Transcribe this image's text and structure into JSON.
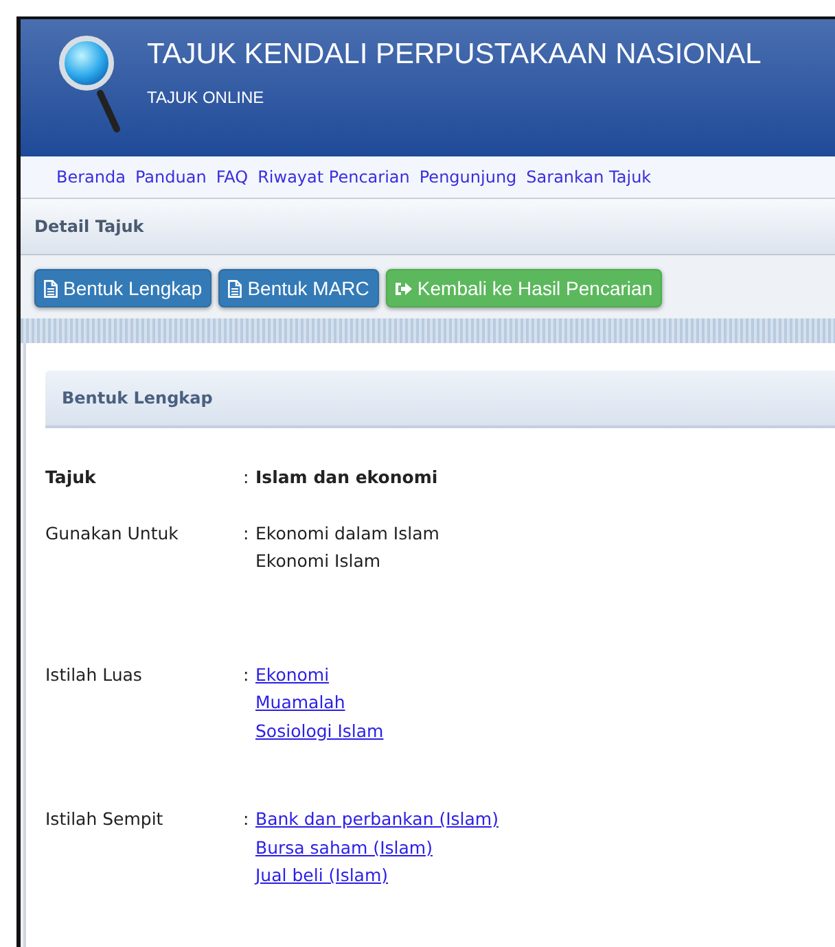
{
  "header": {
    "title": "TAJUK KENDALI PERPUSTAKAAN NASIONAL",
    "subtitle": "TAJUK ONLINE"
  },
  "nav": [
    "Beranda",
    "Panduan",
    "FAQ",
    "Riwayat Pencarian",
    "Pengunjung",
    "Sarankan Tajuk"
  ],
  "page_title": "Detail Tajuk",
  "buttons": [
    {
      "label": "Bentuk Lengkap",
      "kind": "primary"
    },
    {
      "label": "Bentuk MARC",
      "kind": "primary"
    },
    {
      "label": "Kembali ke Hasil Pencarian",
      "kind": "success"
    }
  ],
  "section": {
    "title": "Bentuk Lengkap",
    "fields": [
      {
        "label": "Tajuk",
        "separator": ":",
        "kind": "bold",
        "values": [
          "Islam dan ekonomi"
        ]
      },
      {
        "label": "Gunakan Untuk",
        "separator": ":",
        "kind": "text",
        "values": [
          "Ekonomi dalam Islam",
          "Ekonomi Islam"
        ]
      },
      {
        "label": "Istilah Luas",
        "separator": ":",
        "kind": "link",
        "values": [
          "Ekonomi",
          "Muamalah",
          "Sosiologi Islam"
        ]
      },
      {
        "label": "Istilah Sempit",
        "separator": ":",
        "kind": "link",
        "values": [
          "Bank dan perbankan (Islam)",
          "Bursa saham (Islam)",
          "Jual beli (Islam)"
        ]
      }
    ]
  }
}
